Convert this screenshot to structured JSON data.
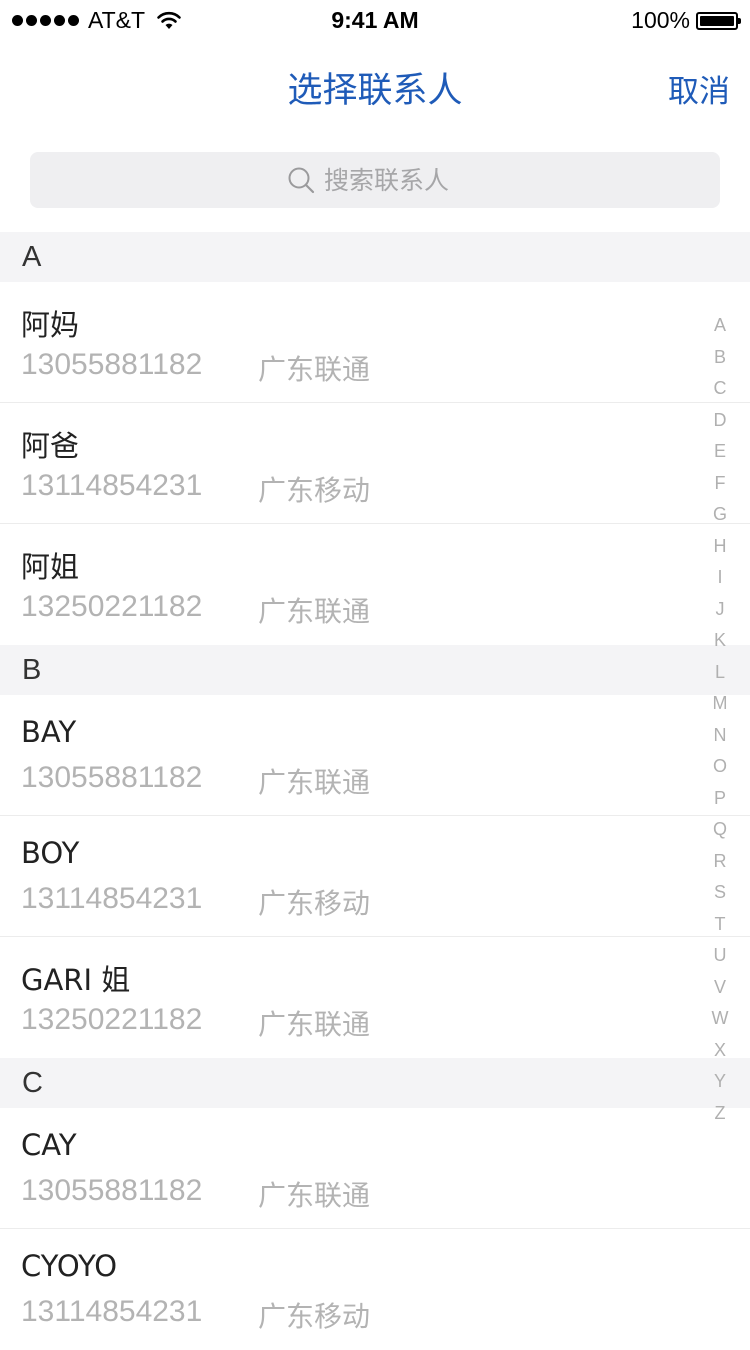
{
  "status_bar": {
    "carrier": "AT&T",
    "time": "9:41 AM",
    "battery_percent": "100%",
    "signal_bars": 5,
    "battery_level": 1.0
  },
  "nav": {
    "title": "选择联系人",
    "cancel_label": "取消"
  },
  "search": {
    "placeholder": "搜索联系人",
    "value": ""
  },
  "sections": [
    {
      "letter": "A",
      "contacts": [
        {
          "name": "阿妈",
          "phone": "13055881182",
          "carrier": "广东联通"
        },
        {
          "name": "阿爸",
          "phone": "13114854231",
          "carrier": "广东移动"
        },
        {
          "name": "阿姐",
          "phone": "13250221182",
          "carrier": "广东联通"
        }
      ]
    },
    {
      "letter": "B",
      "contacts": [
        {
          "name": "BAY",
          "phone": "13055881182",
          "carrier": "广东联通"
        },
        {
          "name": "BOY",
          "phone": "13114854231",
          "carrier": "广东移动"
        },
        {
          "name": "GARI 姐",
          "phone": "13250221182",
          "carrier": "广东联通"
        }
      ]
    },
    {
      "letter": "C",
      "contacts": [
        {
          "name": "CAY",
          "phone": "13055881182",
          "carrier": "广东联通"
        },
        {
          "name": "CYOYO",
          "phone": "13114854231",
          "carrier": "广东移动"
        }
      ]
    }
  ],
  "index_letters": [
    "A",
    "B",
    "C",
    "D",
    "E",
    "F",
    "G",
    "H",
    "I",
    "J",
    "K",
    "L",
    "M",
    "N",
    "O",
    "P",
    "Q",
    "R",
    "S",
    "T",
    "U",
    "V",
    "W",
    "X",
    "Y",
    "Z"
  ],
  "colors": {
    "accent": "#1f5bb8",
    "secondary_text": "#b3b3b3",
    "section_bg": "#f4f4f6",
    "search_bg": "#efeff1"
  },
  "icons": {
    "search": "search-icon",
    "wifi": "wifi-icon",
    "battery": "battery-icon"
  }
}
